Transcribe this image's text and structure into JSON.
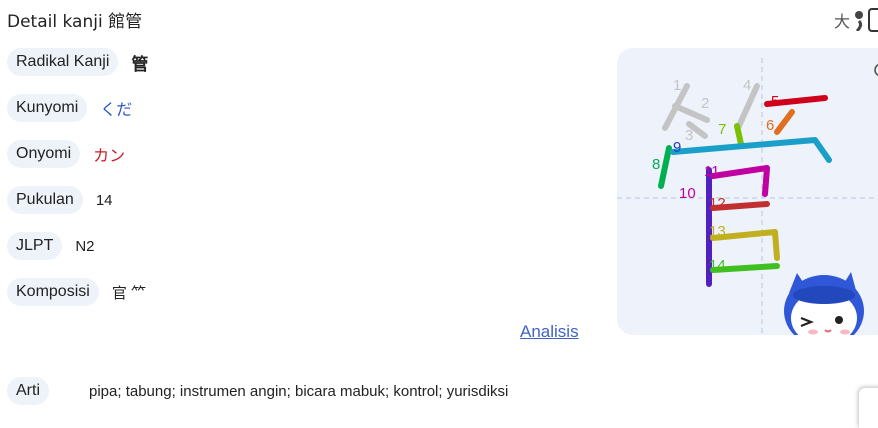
{
  "header": {
    "title": "Detail kanji 館管",
    "ji_label": "大"
  },
  "details": [
    {
      "label": "Radikal Kanji",
      "value": "管"
    },
    {
      "label": "Kunyomi",
      "value": "くだ"
    },
    {
      "label": "Onyomi",
      "value": "カン"
    },
    {
      "label": "Pukulan",
      "value": "14"
    },
    {
      "label": "JLPT",
      "value": "N2"
    },
    {
      "label": "Komposisi",
      "value": "官 ⺮"
    }
  ],
  "analysis_link": "Analisis",
  "meaning": {
    "label": "Arti",
    "value": "pipa; tabung; instrumen angin; bicara mabuk; kontrol; yurisdiksi"
  },
  "stroke_order": {
    "numbers": [
      "1",
      "2",
      "3",
      "4",
      "5",
      "6",
      "7",
      "8",
      "9",
      "10",
      "11",
      "12",
      "13",
      "14"
    ],
    "colors": [
      "#c8c8c8",
      "#c8c8c8",
      "#c8c8c8",
      "#c8c8c8",
      "#d0021b",
      "#e07020",
      "#7ac000",
      "#00b050",
      "#1aa0c8",
      "#1e3cc8",
      "#c000a0",
      "#c03030",
      "#c0b020",
      "#40c020"
    ]
  }
}
